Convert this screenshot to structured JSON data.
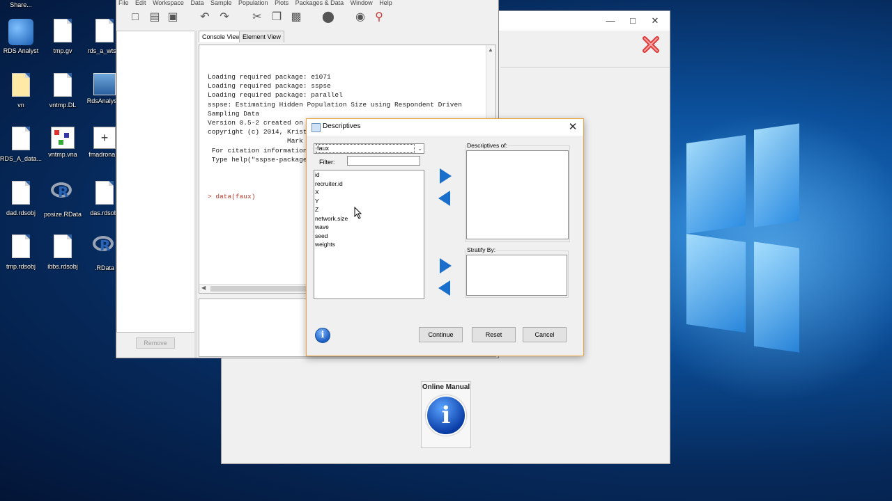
{
  "desktop": {
    "icons": [
      {
        "label": "Share...",
        "kind": "partial"
      },
      {
        "label": "RDS Analyst",
        "kind": "app"
      },
      {
        "label": "tmp.gv",
        "kind": "doc"
      },
      {
        "label": "rds_a_wts...",
        "kind": "doc"
      },
      {
        "label": "vn",
        "kind": "doc"
      },
      {
        "label": "vntmp.DL",
        "kind": "doc"
      },
      {
        "label": "RdsAnalys...",
        "kind": "app"
      },
      {
        "label": "RDS_A_data...",
        "kind": "doc"
      },
      {
        "label": "vntmp.vna",
        "kind": "app"
      },
      {
        "label": "fmadrona...",
        "kind": "app"
      },
      {
        "label": "dad.rdsobj",
        "kind": "doc"
      },
      {
        "label": "posize.RData",
        "kind": "r"
      },
      {
        "label": "das.rdsobj",
        "kind": "doc"
      },
      {
        "label": "tmp.rdsobj",
        "kind": "doc"
      },
      {
        "label": "ibbs.rdsobj",
        "kind": "doc"
      },
      {
        "label": ".RData",
        "kind": "r"
      }
    ]
  },
  "main_window": {
    "menu": [
      "File",
      "Edit",
      "Workspace",
      "Data",
      "Sample",
      "Population",
      "Plots",
      "Packages & Data",
      "Window",
      "Help"
    ],
    "tabs": [
      "Console View",
      "Element View"
    ],
    "remove_label": "Remove",
    "console_text": "Loading required package: e1071\nLoading required package: sspse\nLoading required package: parallel\nsspse: Estimating Hidden Population Size using Respondent Driven\nSampling Data\nVersion 0.5-2 created on 2\ncopyright (c) 2014, Krista\n                    Mark S\n For citation information,\n Type help(\"sspse-package\"",
    "prompt": "> data(faux)"
  },
  "second_window": {
    "manual_label": "Online Manual"
  },
  "dialog": {
    "title": "Descriptives",
    "dataset": "faux",
    "filter_label": "Filter:",
    "filter_value": "",
    "variables": [
      "id",
      "recruiter.id",
      "X",
      "Y",
      "Z",
      "network.size",
      "wave",
      "seed",
      "weights"
    ],
    "descriptives_label": "Descriptives of:",
    "stratify_label": "Stratify By:",
    "buttons": {
      "continue": "Continue",
      "reset": "Reset",
      "cancel": "Cancel"
    }
  },
  "colors": {
    "accent_arrow": "#1b6fcc",
    "dialog_border": "#f0a23a",
    "prompt": "#c0392b"
  }
}
